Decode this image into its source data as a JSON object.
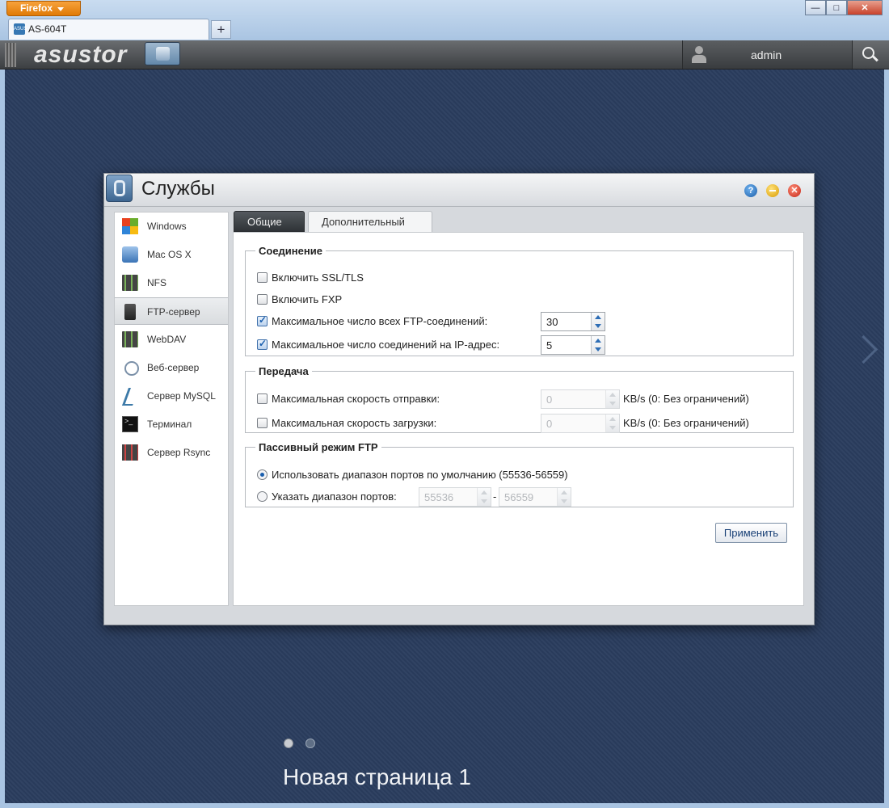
{
  "browser": {
    "menu_button": "Firefox",
    "tab_title": "AS-604T",
    "favicon_text": "ASUS",
    "new_tab": "+",
    "window_controls": {
      "minimize": "—",
      "maximize": "□",
      "close": "✕"
    }
  },
  "topbar": {
    "logo": "asustor",
    "user": "admin"
  },
  "window": {
    "title": "Службы",
    "buttons": {
      "help": "?",
      "close": "✕"
    },
    "sidebar": [
      {
        "label": "Windows",
        "icon": "windows-icon"
      },
      {
        "label": "Mac OS X",
        "icon": "mac-icon"
      },
      {
        "label": "NFS",
        "icon": "nfs-icon"
      },
      {
        "label": "FTP-сервер",
        "icon": "ftp-icon",
        "active": true
      },
      {
        "label": "WebDAV",
        "icon": "webdav-icon"
      },
      {
        "label": "Веб-сервер",
        "icon": "web-server-icon"
      },
      {
        "label": "Сервер MySQL",
        "icon": "mysql-icon"
      },
      {
        "label": "Терминал",
        "icon": "terminal-icon"
      },
      {
        "label": "Сервер Rsync",
        "icon": "rsync-icon"
      }
    ],
    "tabs": [
      {
        "label": "Общие"
      },
      {
        "label": "Дополнительный",
        "active": true
      }
    ],
    "connection": {
      "legend": "Соединение",
      "ssl": {
        "label": "Включить SSL/TLS",
        "checked": false
      },
      "fxp": {
        "label": "Включить FXP",
        "checked": false
      },
      "max_all": {
        "label": "Максимальное число всех FTP-соединений:",
        "checked": true,
        "value": "30"
      },
      "max_ip": {
        "label": "Максимальное число соединений на IP-адрес:",
        "checked": true,
        "value": "5"
      }
    },
    "transfer": {
      "legend": "Передача",
      "upload": {
        "label": "Максимальная скорость отправки:",
        "checked": false,
        "value": "0",
        "unit": "KB/s (0: Без ограничений)"
      },
      "download": {
        "label": "Максимальная скорость загрузки:",
        "checked": false,
        "value": "0",
        "unit": "KB/s (0: Без ограничений)"
      }
    },
    "passive": {
      "legend": "Пассивный режим FTP",
      "default_range": {
        "label": "Использовать диапазон портов по умолчанию (55536-56559)",
        "selected": true
      },
      "custom_range": {
        "label": "Указать диапазон портов:",
        "selected": false,
        "from": "55536",
        "to": "56559",
        "separator": "-"
      }
    },
    "apply_label": "Применить"
  },
  "desktop": {
    "page_name": "Новая страница 1",
    "pages": 2,
    "current_page": 1
  },
  "colors": {
    "desktop_bg": "#2a3d5e",
    "accent": "#1b5fae",
    "firefox_orange": "#e07a06"
  }
}
